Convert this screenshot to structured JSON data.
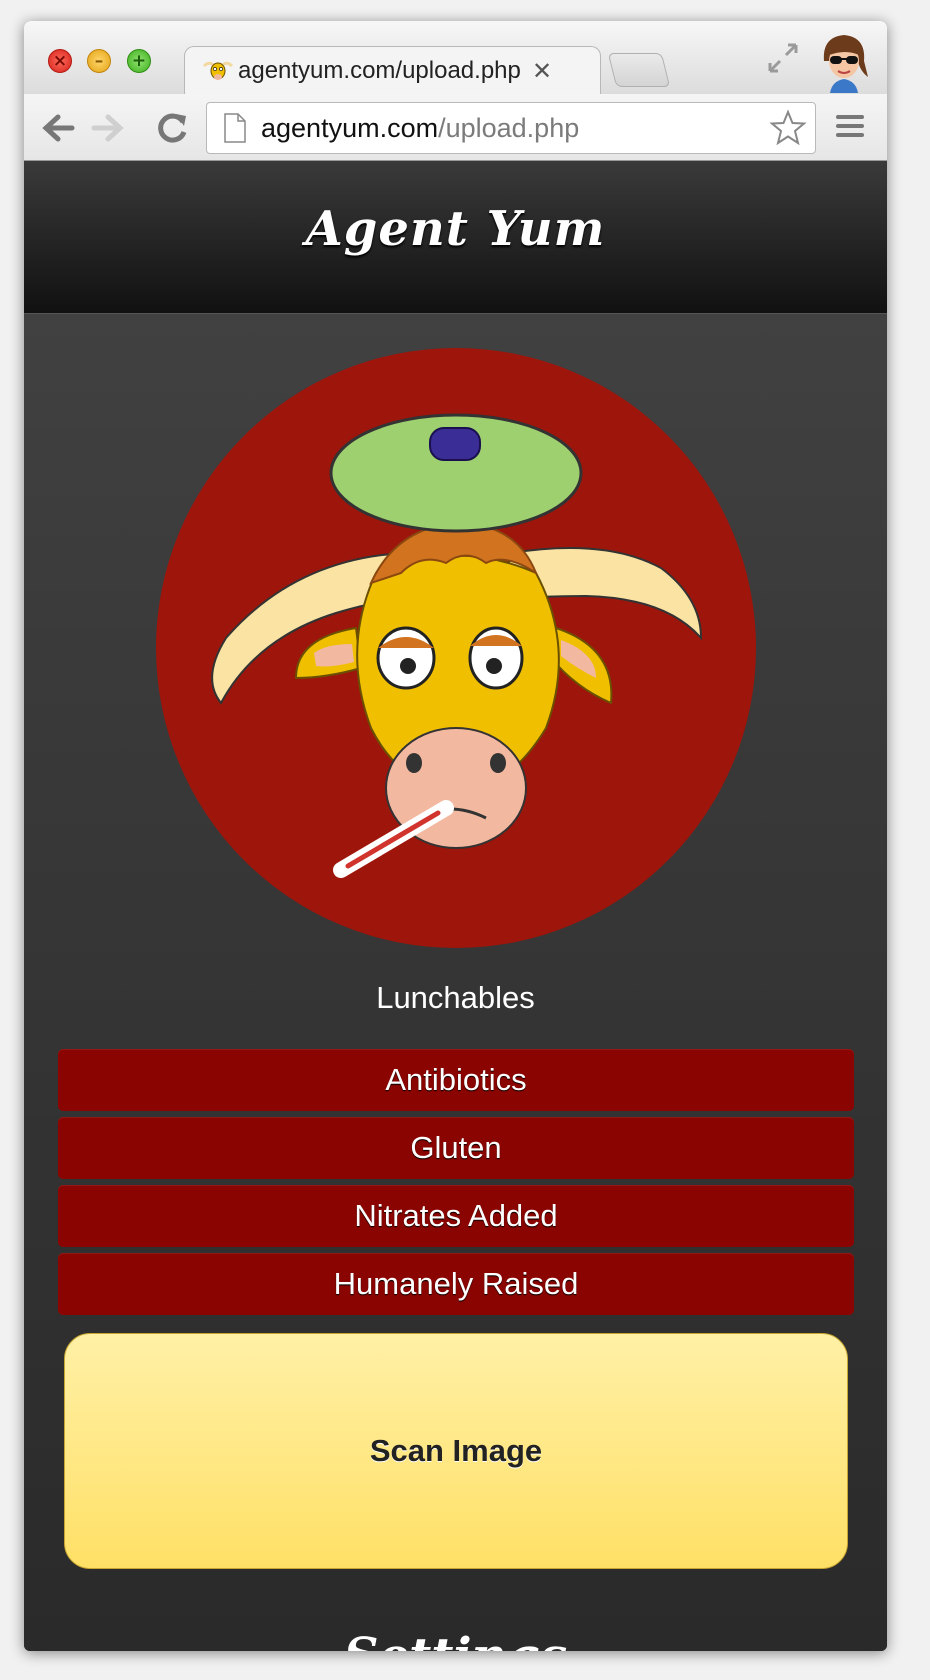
{
  "browser": {
    "tab_title": "agentyum.com/upload.php",
    "tab_close_glyph": "✕",
    "url_host": "agentyum.com",
    "url_path": "/upload.php",
    "icons": [
      "close-window-icon",
      "minimize-window-icon",
      "maximize-window-icon",
      "favicon-bull-icon",
      "fullscreen-icon",
      "profile-avatar-icon",
      "back-arrow-icon",
      "forward-arrow-icon",
      "reload-icon",
      "page-icon",
      "bookmark-star-icon",
      "menu-icon"
    ]
  },
  "app": {
    "logo": "Agent Yum",
    "product_name": "Lunchables",
    "flags": [
      "Antibiotics",
      "Gluten",
      "Nitrates Added",
      "Humanely Raised"
    ],
    "scan_button_label": "Scan Image",
    "settings_heading": "Settings",
    "colors": {
      "flag_background": "#8a0501",
      "result_circle": "#9e150b",
      "scan_button": "#ffe066"
    }
  }
}
